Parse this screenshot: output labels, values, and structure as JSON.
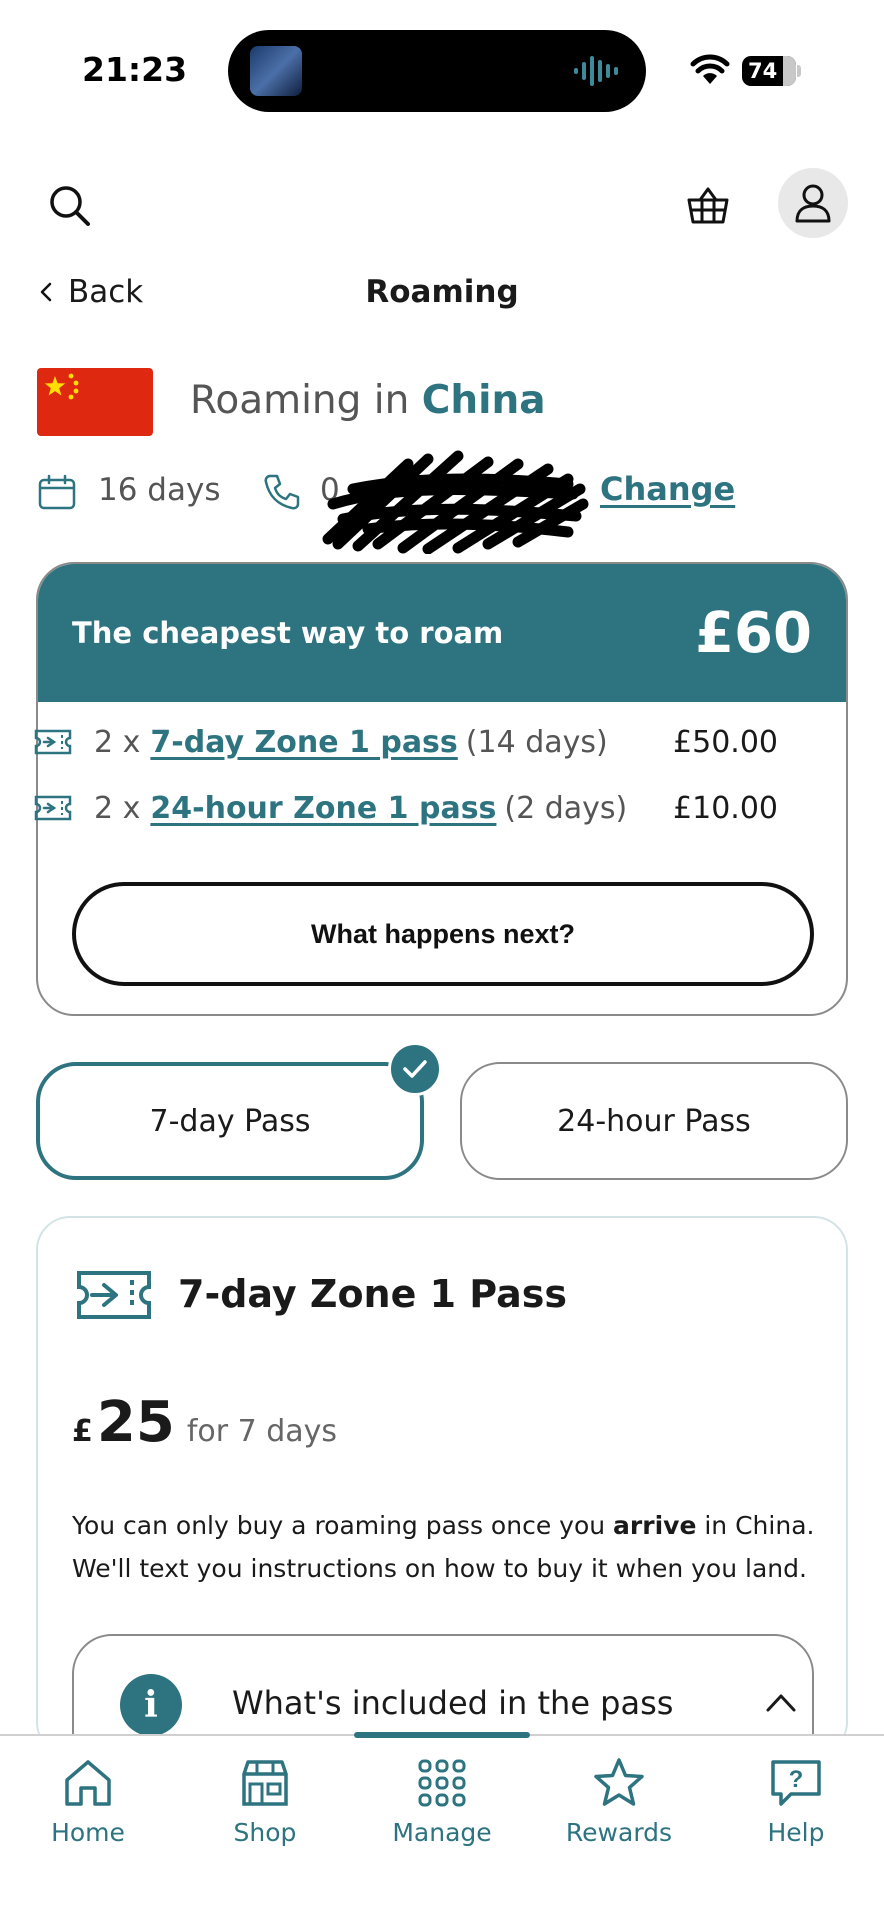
{
  "status_bar": {
    "time": "21:23",
    "battery": "74"
  },
  "nav": {
    "back_label": "Back",
    "page_title": "Roaming"
  },
  "header": {
    "roaming_prefix": "Roaming in",
    "country": "China",
    "days": "16 days",
    "phone_number_visible": "0",
    "change_label": "Change"
  },
  "cheapest": {
    "title": "The cheapest way to roam",
    "total": "£60",
    "lines": [
      {
        "qty": "2 x",
        "pass_name": "7-day Zone 1 pass",
        "duration": "(14 days)",
        "amount": "£50.00"
      },
      {
        "qty": "2 x",
        "pass_name": "24-hour Zone 1 pass",
        "duration": "(2 days)",
        "amount": "£10.00"
      }
    ],
    "next_button": "What happens next?"
  },
  "pass_toggle": {
    "options": [
      "7-day Pass",
      "24-hour Pass"
    ],
    "selected": "7-day Pass"
  },
  "detail": {
    "title": "7-day Zone 1 Pass",
    "currency": "£",
    "price": "25",
    "period": "for 7 days",
    "text_before": "You can only buy a roaming pass once you",
    "text_bold": "arrive",
    "text_after": "in China. We'll text you instructions on how to buy it when you land.",
    "included_label": "What's included in the pass"
  },
  "bottom_nav": {
    "items": [
      "Home",
      "Shop",
      "Manage",
      "Rewards",
      "Help"
    ],
    "active": "Manage"
  },
  "colors": {
    "accent": "#2d7480",
    "flag_red": "#de2910",
    "flag_star": "#ffde00"
  }
}
